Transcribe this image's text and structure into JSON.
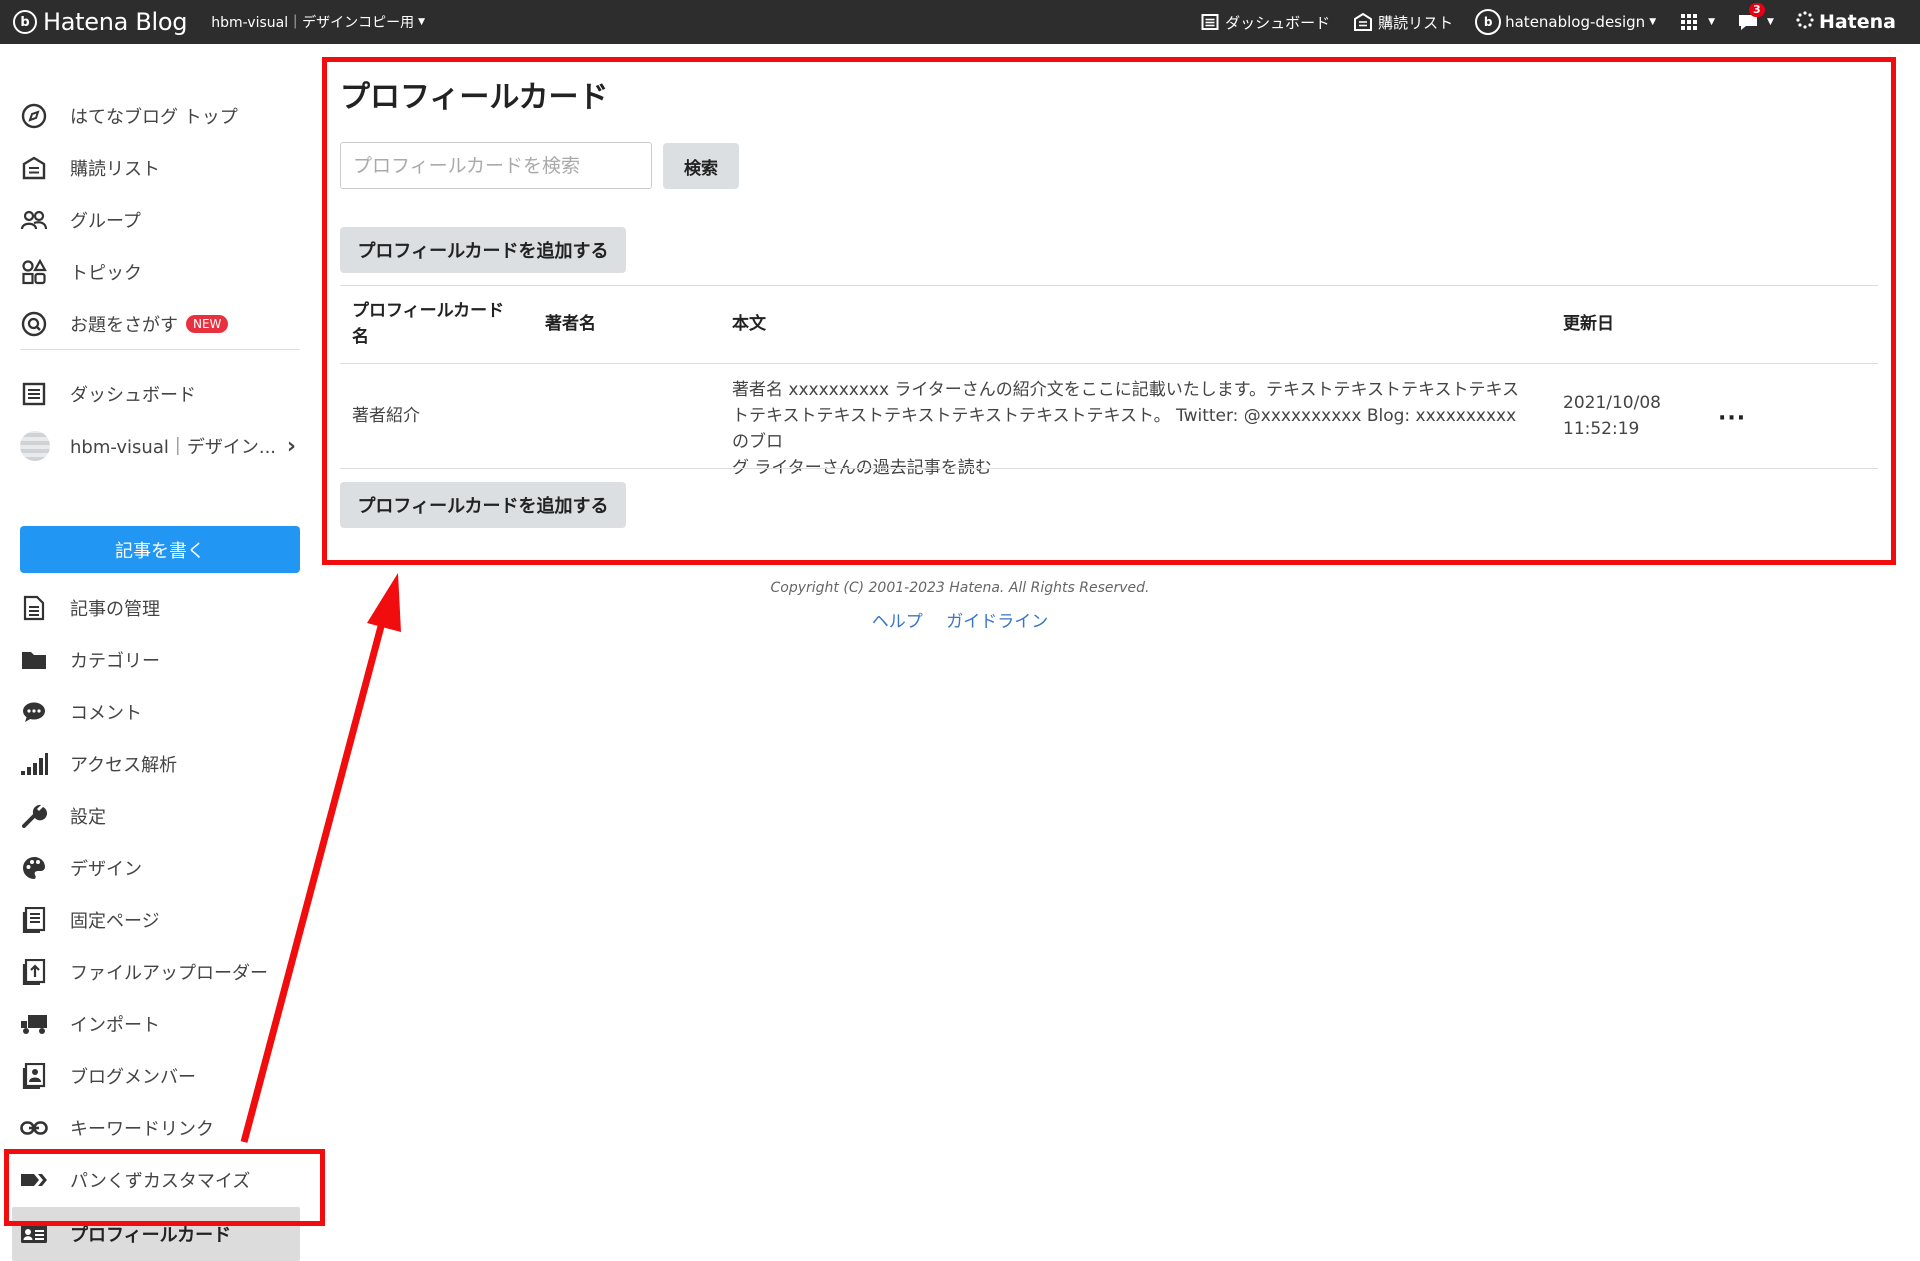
{
  "topbar": {
    "brand_name": "Hatena Blog",
    "brand_mark": "b",
    "blog_selector": "hbm-visual｜デザインコピー用",
    "links": {
      "dashboard": "ダッシュボード",
      "subscriptions": "購読リスト",
      "user": "hatenablog-design"
    },
    "notification_count": "3",
    "hatena_label": "Hatena"
  },
  "sidebar": {
    "top_items": [
      {
        "label": "はてなブログ トップ",
        "icon": "compass-icon"
      },
      {
        "label": "購読リスト",
        "icon": "subscription-icon"
      },
      {
        "label": "グループ",
        "icon": "group-icon"
      },
      {
        "label": "トピック",
        "icon": "topic-icon"
      },
      {
        "label": "お題をさがす",
        "icon": "theme-search-icon",
        "badge": "NEW"
      }
    ],
    "dashboard_label": "ダッシュボード",
    "blog_label": "hbm-visual｜デザイン...",
    "write_button": "記事を書く",
    "manage_items": [
      {
        "label": "記事の管理",
        "icon": "document-icon"
      },
      {
        "label": "カテゴリー",
        "icon": "folder-icon"
      },
      {
        "label": "コメント",
        "icon": "comment-icon"
      },
      {
        "label": "アクセス解析",
        "icon": "bar-chart-icon"
      },
      {
        "label": "設定",
        "icon": "wrench-icon"
      },
      {
        "label": "デザイン",
        "icon": "palette-icon"
      },
      {
        "label": "固定ページ",
        "icon": "pages-icon"
      },
      {
        "label": "ファイルアップローダー",
        "icon": "upload-icon"
      },
      {
        "label": "インポート",
        "icon": "truck-icon"
      },
      {
        "label": "ブログメンバー",
        "icon": "member-icon"
      },
      {
        "label": "キーワードリンク",
        "icon": "link-icon"
      },
      {
        "label": "パンくずカスタマイズ",
        "icon": "breadcrumb-icon"
      },
      {
        "label": "プロフィールカード",
        "icon": "id-card-icon"
      }
    ]
  },
  "main": {
    "title": "プロフィールカード",
    "search_placeholder": "プロフィールカードを検索",
    "search_button": "検索",
    "add_button": "プロフィールカードを追加する",
    "table": {
      "headers": {
        "name_line1": "プロフィールカード",
        "name_line2": "名",
        "author": "著者名",
        "body": "本文",
        "updated": "更新日"
      },
      "rows": [
        {
          "name": "著者紹介",
          "author": "",
          "body_line1": "著者名 xxxxxxxxxx ライターさんの紹介文をここに記載いたします。テキストテキストテキストテキス",
          "body_line2": "トテキストテキストテキストテキストテキストテキスト。 Twitter: @xxxxxxxxxx Blog: xxxxxxxxxxのブロ",
          "body_line3": "グ ライターさんの過去記事を読む",
          "updated_date": "2021/10/08",
          "updated_time": "11:52:19",
          "actions": "···"
        }
      ]
    }
  },
  "footer": {
    "copyright": "Copyright (C) 2001-2023 Hatena. All Rights Reserved.",
    "help": "ヘルプ",
    "guideline": "ガイドライン"
  },
  "annotation": {
    "color": "#f10d0d"
  }
}
